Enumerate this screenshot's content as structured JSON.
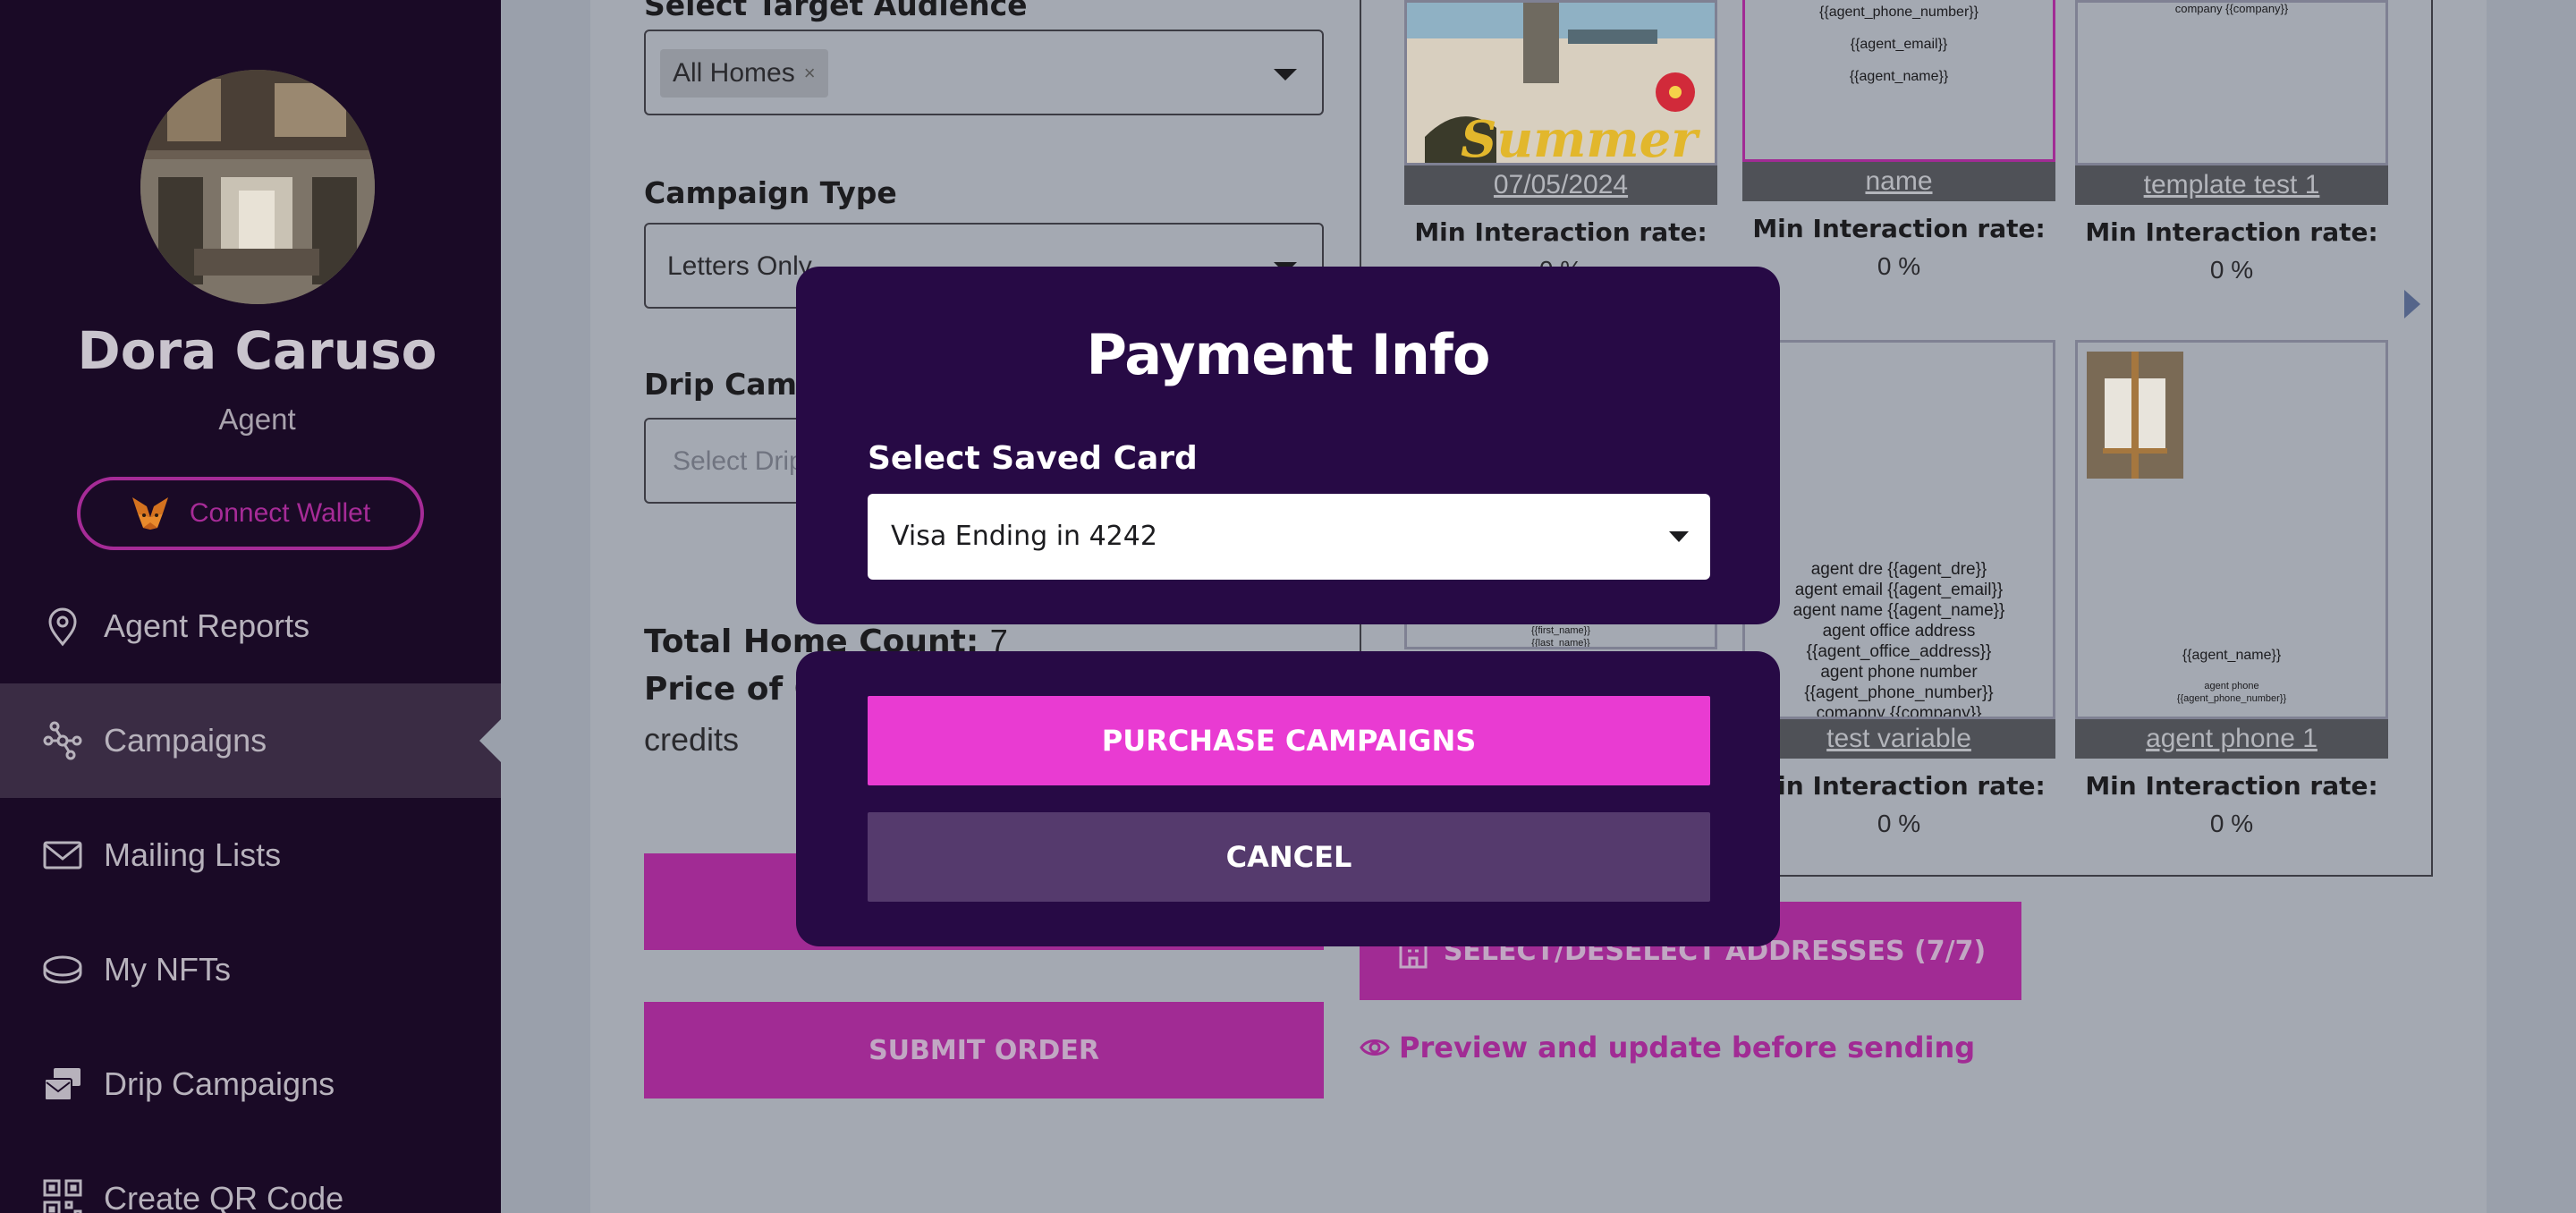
{
  "sidebar": {
    "agent_name": "Dora Caruso",
    "agent_role": "Agent",
    "wallet_label": "Connect Wallet",
    "items": [
      {
        "label": "Agent Reports",
        "icon": "location-pin-icon"
      },
      {
        "label": "Campaigns",
        "icon": "network-icon",
        "active": true
      },
      {
        "label": "Mailing Lists",
        "icon": "envelope-icon"
      },
      {
        "label": "My NFTs",
        "icon": "coin-icon"
      },
      {
        "label": "Drip Campaigns",
        "icon": "mail-stack-icon"
      },
      {
        "label": "Create QR Code",
        "icon": "qr-code-icon"
      }
    ]
  },
  "form": {
    "target_audience_label": "Select Target Audience",
    "audience_chip": "All Homes",
    "audience_chip_remove": "×",
    "campaign_type_label": "Campaign Type",
    "campaign_type_value": "Letters Only",
    "drip_label": "Drip Campaign",
    "drip_placeholder": "Select Drip Campaign",
    "total_label": "Total Home Count:",
    "total_value": "7",
    "price_label": "Price of Campaign:",
    "credits_text": "credits",
    "submit_label": "SUBMIT ORDER",
    "select_addresses_label": "SELECT/DESELECT ADDRESSES (7/7)",
    "preview_label": "Preview and update before sending"
  },
  "templates": {
    "rate_label": "Min Interaction rate:",
    "cards": [
      {
        "name": "07/05/2024",
        "rate": "0 %"
      },
      {
        "name": "name",
        "rate": "0 %",
        "lines": [
          "{{agent_phone_number}}",
          "{{agent_email}}",
          "{{agent_name}}"
        ]
      },
      {
        "name": "template test 1",
        "rate": "0 %",
        "lines": [
          "company {{company}}"
        ]
      },
      {
        "name": "",
        "rate": "",
        "lines": [
          "{{first_name}}",
          "{{last_name}}"
        ]
      },
      {
        "name": "test variable",
        "rate": "0 %",
        "lines": [
          "agent dre {{agent_dre}}",
          "agent email {{agent_email}}",
          "agent name {{agent_name}}",
          "agent office address",
          "{{agent_office_address}}",
          "agent phone number",
          "{{agent_phone_number}}",
          "comapny {{company}}"
        ]
      },
      {
        "name": "agent phone 1",
        "rate": "0 %",
        "lines": [
          "{{agent_name}}",
          "agent phone",
          "{{agent_phone_number}}"
        ]
      }
    ]
  },
  "modal": {
    "title": "Payment Info",
    "card_label": "Select Saved Card",
    "card_value": "Visa Ending in 4242",
    "purchase_label": "PURCHASE CAMPAIGNS",
    "cancel_label": "CANCEL"
  },
  "colors": {
    "sidebar_bg": "#1a0a26",
    "modal_bg": "#270a45",
    "accent_magenta": "#e93bd2",
    "cancel_bg": "#553a6d"
  }
}
